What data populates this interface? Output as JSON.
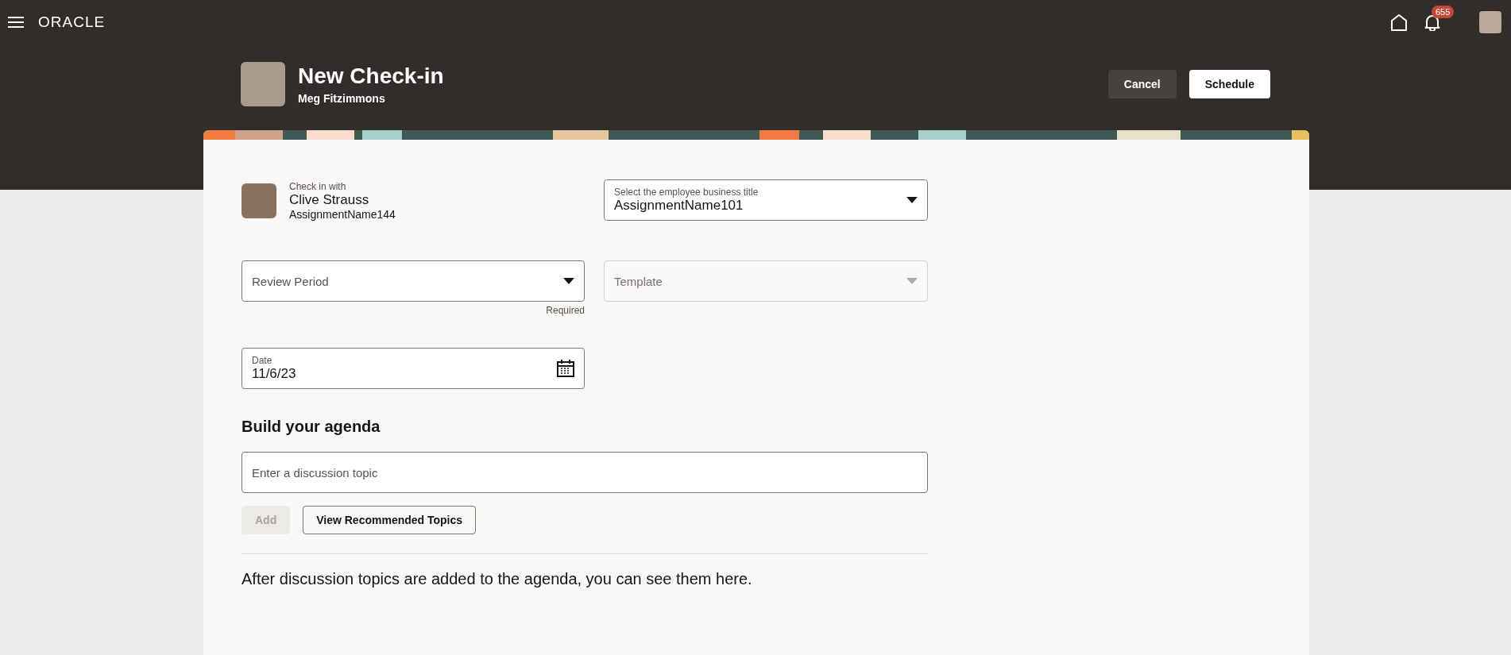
{
  "top_bar": {
    "logo": "ORACLE",
    "notification_count": "655"
  },
  "header": {
    "title": "New Check-in",
    "subtitle": "Meg Fitzimmons",
    "buttons": [
      {
        "label": "Cancel",
        "kind": "secondary"
      },
      {
        "label": "Schedule",
        "kind": "primary"
      }
    ]
  },
  "check_in_with": {
    "label": "Check in with",
    "name": "Clive Strauss",
    "assignment": "AssignmentName144"
  },
  "business_title": {
    "label": "Select the employee business title",
    "value": "AssignmentName101"
  },
  "review_period": {
    "placeholder": "Review Period",
    "helper": "Required",
    "disabled": false
  },
  "template": {
    "placeholder": "Template",
    "disabled": true
  },
  "date": {
    "label": "Date",
    "value": "11/6/23"
  },
  "agenda": {
    "heading": "Build your agenda",
    "topic_placeholder": "Enter a discussion topic",
    "buttons": [
      {
        "label": "Add",
        "disabled": true
      },
      {
        "label": "View Recommended Topics",
        "disabled": false
      }
    ],
    "empty_message": "After discussion topics are added to the agenda, you can see them here."
  }
}
